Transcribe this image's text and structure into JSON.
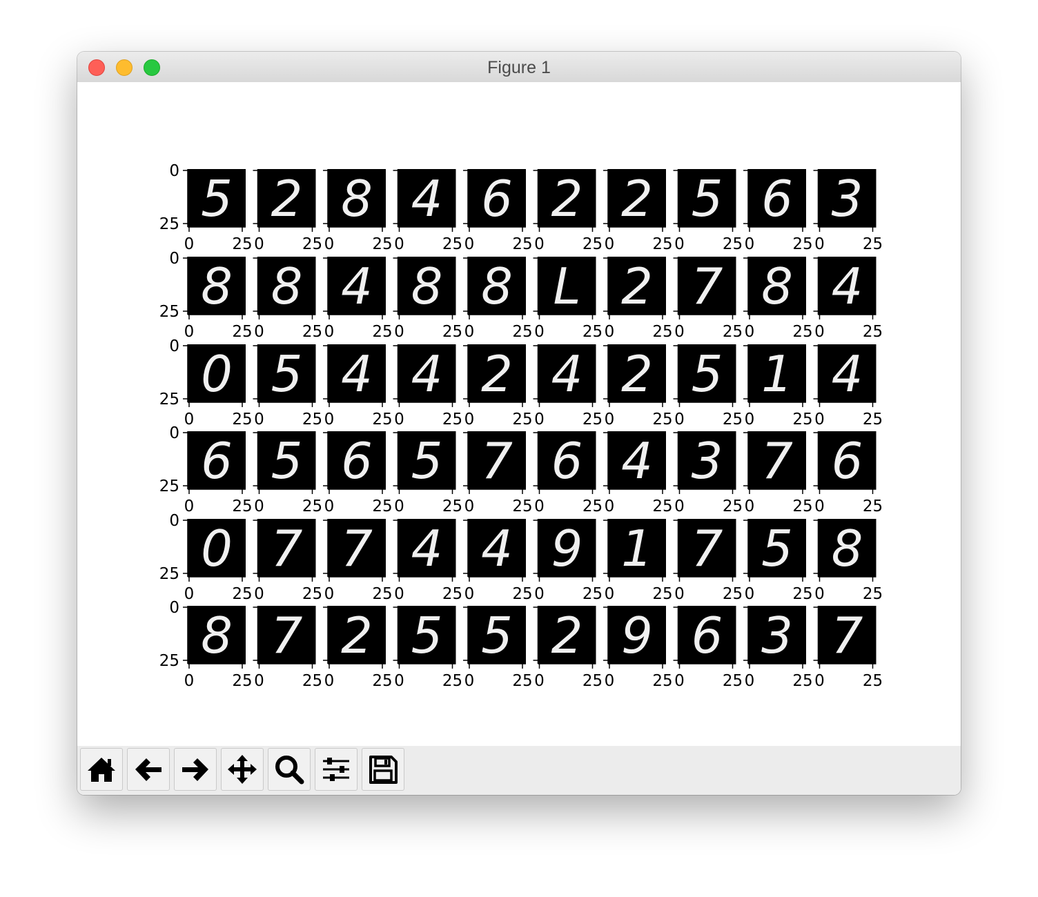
{
  "window": {
    "title": "Figure 1"
  },
  "toolbar": {
    "buttons": [
      {
        "name": "home-button",
        "icon": "home-icon"
      },
      {
        "name": "back-button",
        "icon": "arrow-left-icon"
      },
      {
        "name": "forward-button",
        "icon": "arrow-right-icon"
      },
      {
        "name": "pan-button",
        "icon": "move-icon"
      },
      {
        "name": "zoom-button",
        "icon": "magnifier-icon"
      },
      {
        "name": "configure-subplots-button",
        "icon": "sliders-icon"
      },
      {
        "name": "save-button",
        "icon": "floppy-disk-icon"
      }
    ]
  },
  "figure": {
    "rows": 6,
    "cols": 10,
    "ytick_labels": [
      "0",
      "25"
    ],
    "xtick_labels": [
      "0",
      "25"
    ],
    "digits": [
      "5",
      "2",
      "8",
      "4",
      "6",
      "2",
      "2",
      "5",
      "6",
      "3",
      "8",
      "8",
      "4",
      "8",
      "8",
      "L",
      "2",
      "7",
      "8",
      "4",
      "0",
      "5",
      "4",
      "4",
      "2",
      "4",
      "2",
      "5",
      "1",
      "4",
      "6",
      "5",
      "6",
      "5",
      "7",
      "6",
      "4",
      "3",
      "7",
      "6",
      "0",
      "7",
      "7",
      "4",
      "4",
      "9",
      "1",
      "7",
      "5",
      "8",
      "8",
      "7",
      "2",
      "5",
      "5",
      "2",
      "9",
      "6",
      "3",
      "7"
    ],
    "colors": {
      "panel": "#000000",
      "stroke": "#f0f0f0",
      "axis": "#000000"
    }
  }
}
